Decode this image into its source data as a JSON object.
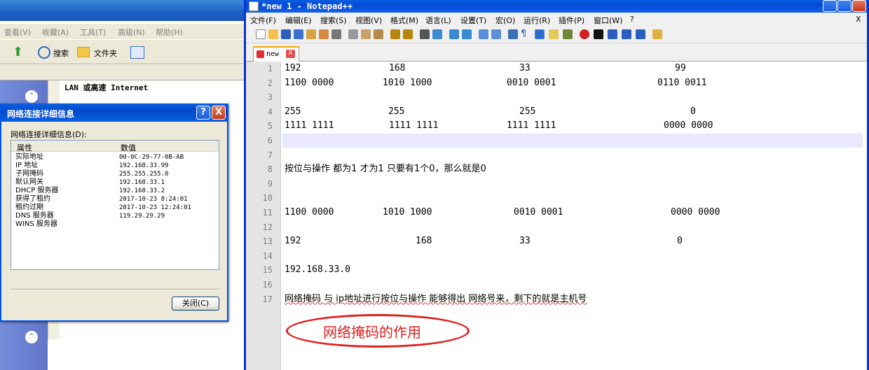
{
  "explorer": {
    "menu": [
      "查看(V)",
      "收藏(A)",
      "工具(T)",
      "高级(N)",
      "帮助(H)"
    ],
    "toolbar": {
      "search": "搜索",
      "folders": "文件夹"
    },
    "content_label": "LAN 或高速 Internet"
  },
  "dialog": {
    "title": "网络连接详细信息",
    "help": "?",
    "close": "X",
    "label": "网络连接详细信息(D):",
    "columns": [
      "属性",
      "数值"
    ],
    "rows": [
      {
        "k": "实际地址",
        "v": "00-0C-29-77-0B-AB"
      },
      {
        "k": "IP 地址",
        "v": "192.168.33.99"
      },
      {
        "k": "子网掩码",
        "v": "255.255.255.0"
      },
      {
        "k": "默认网关",
        "v": "192.168.33.1"
      },
      {
        "k": "DHCP 服务器",
        "v": "192.168.33.2"
      },
      {
        "k": "获得了租约",
        "v": "2017-10-23 8:24:01"
      },
      {
        "k": "租约过期",
        "v": "2017-10-23 12:24:01"
      },
      {
        "k": "DNS 服务器",
        "v": "119.29.29.29"
      },
      {
        "k": "WINS 服务器",
        "v": ""
      }
    ],
    "close_button": "关闭(C)"
  },
  "npp": {
    "title": "*new  1 - Notepad++",
    "menu": [
      "文件(F)",
      "编辑(E)",
      "搜索(S)",
      "视图(V)",
      "格式(M)",
      "语言(L)",
      "设置(T)",
      "宏(O)",
      "运行(R)",
      "插件(P)",
      "窗口(W)",
      "?"
    ],
    "menu_close": "X",
    "tab": {
      "label": "new",
      "close": "X"
    },
    "lines": [
      {
        "n": "1",
        "cells": [
          "192",
          "168",
          "33",
          "99"
        ]
      },
      {
        "n": "2",
        "cells": [
          "1100 0000",
          "1010 1000",
          "0010 0001",
          "0110 0011"
        ]
      },
      {
        "n": "3",
        "cells": []
      },
      {
        "n": "4",
        "cells": [
          "255",
          "255",
          "255",
          "0"
        ]
      },
      {
        "n": "5",
        "cells": [
          "1111 1111",
          "1111 1111",
          "1111 1111",
          "0000 0000"
        ]
      },
      {
        "n": "6",
        "cells": []
      },
      {
        "n": "7",
        "cells": []
      },
      {
        "n": "8",
        "cells": [
          "按位与操作  都为1 才为1  只要有1个0，那么就是0"
        ]
      },
      {
        "n": "9",
        "cells": []
      },
      {
        "n": "10",
        "cells": []
      },
      {
        "n": "11",
        "cells": [
          "1100 0000",
          "1010 1000",
          "0010 0001",
          "0000 0000"
        ]
      },
      {
        "n": "12",
        "cells": []
      },
      {
        "n": "13",
        "cells": [
          "192",
          "168",
          "33",
          "0"
        ]
      },
      {
        "n": "14",
        "cells": []
      },
      {
        "n": "15",
        "cells": [
          "192.168.33.0"
        ]
      },
      {
        "n": "16",
        "cells": []
      },
      {
        "n": "17",
        "cells": [
          "网络掩码 与 ip地址进行按位与操作 能够得出 网络号来，剩下的就是主机号"
        ]
      }
    ],
    "annotation": "网络掩码的作用"
  }
}
